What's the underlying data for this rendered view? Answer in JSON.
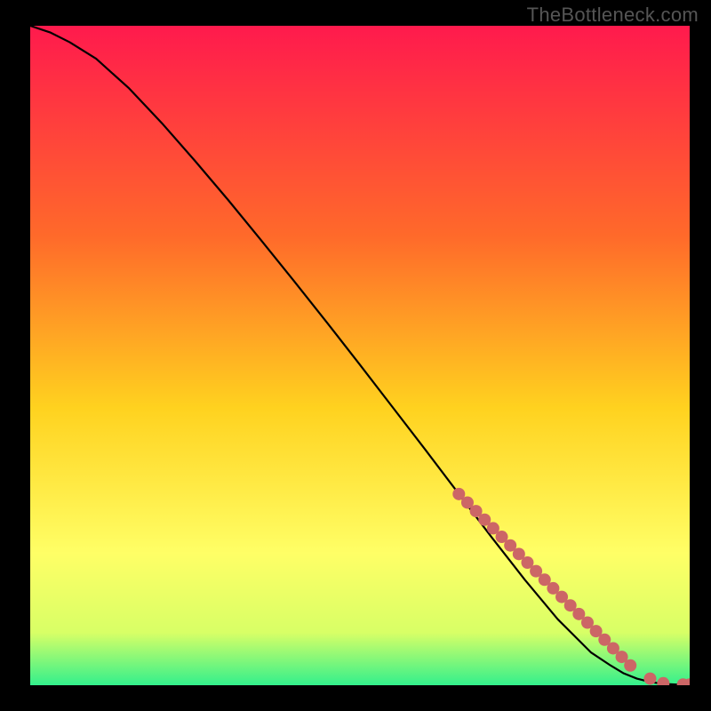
{
  "watermark": "TheBottleneck.com",
  "colors": {
    "background_black": "#000000",
    "watermark_gray": "#555555",
    "curve_black": "#000000",
    "dot_coral": "#cc6666",
    "grad_top": "#ff1a4d",
    "grad_mid1": "#ff6a2a",
    "grad_mid2": "#ffd21f",
    "grad_mid3": "#ffff66",
    "grad_mid4": "#d8ff66",
    "grad_bottom": "#33f08c"
  },
  "chart_data": {
    "type": "line",
    "title": "",
    "xlabel": "",
    "ylabel": "",
    "xlim": [
      0,
      100
    ],
    "ylim": [
      0,
      100
    ],
    "series": [
      {
        "name": "curve",
        "x": [
          0,
          3,
          6,
          10,
          15,
          20,
          25,
          30,
          35,
          40,
          45,
          50,
          55,
          60,
          65,
          70,
          75,
          80,
          85,
          88,
          90,
          92,
          94,
          96,
          98,
          100
        ],
        "y": [
          100,
          99,
          97.5,
          95,
          90.5,
          85.2,
          79.5,
          73.6,
          67.5,
          61.3,
          55.0,
          48.6,
          42.1,
          35.6,
          29.0,
          22.4,
          16.0,
          10.0,
          5.0,
          3.0,
          1.8,
          1.0,
          0.5,
          0.2,
          0.1,
          0.1
        ]
      }
    ],
    "highlight_points": {
      "name": "dots",
      "x": [
        65,
        66.3,
        67.6,
        68.9,
        70.2,
        71.5,
        72.8,
        74.1,
        75.4,
        76.7,
        78.0,
        79.3,
        80.6,
        81.9,
        83.2,
        84.5,
        85.8,
        87.1,
        88.4,
        89.7,
        91.0,
        94.0,
        96.0,
        99.0,
        100.0
      ],
      "y": [
        29.0,
        27.7,
        26.4,
        25.1,
        23.8,
        22.5,
        21.2,
        19.9,
        18.6,
        17.3,
        16.0,
        14.7,
        13.4,
        12.1,
        10.8,
        9.5,
        8.2,
        6.9,
        5.6,
        4.3,
        3.0,
        1.0,
        0.3,
        0.1,
        0.1
      ]
    }
  }
}
